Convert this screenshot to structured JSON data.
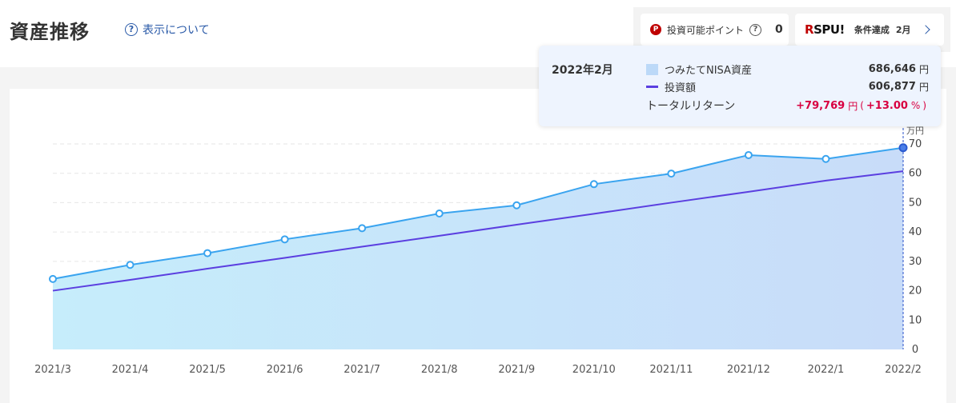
{
  "header": {
    "title": "資産推移",
    "help_label": "表示について",
    "points_label": "投資可能ポイント",
    "points_value": "0",
    "spu_logo_r": "R",
    "spu_logo_text": "SPU!",
    "spu_condition": "条件達成",
    "spu_month": "2月"
  },
  "tooltip": {
    "date": "2022年2月",
    "asset_label": "つみたてNISA資産",
    "asset_value": "686,646",
    "invest_label": "投資額",
    "invest_value": "606,877",
    "return_label": "トータルリターン",
    "return_value": "+79,769",
    "return_pct": "+13.00",
    "unit_yen": "円",
    "unit_pct": "%",
    "paren_open": "(",
    "paren_close": ")"
  },
  "colors": {
    "asset_line": "#3aa4ef",
    "asset_fill_left": "#c6edfb",
    "asset_fill_right": "#c8dcf9",
    "invest_line": "#5b3fe0",
    "grid": "#e6e6e6",
    "hover_line": "#2850c8"
  },
  "chart_data": {
    "type": "area",
    "categories": [
      "2021/3",
      "2021/4",
      "2021/5",
      "2021/6",
      "2021/7",
      "2021/8",
      "2021/9",
      "2021/10",
      "2021/11",
      "2021/12",
      "2022/1",
      "2022/2"
    ],
    "series": [
      {
        "name": "つみたてNISA資産",
        "type": "area",
        "values": [
          24.0,
          28.8,
          32.8,
          37.5,
          41.3,
          46.3,
          49.1,
          56.3,
          59.9,
          66.2,
          64.9,
          68.7
        ]
      },
      {
        "name": "投資額",
        "type": "line",
        "values": [
          20.0,
          23.7,
          27.5,
          31.2,
          35.0,
          38.7,
          42.5,
          46.2,
          50.0,
          53.7,
          57.5,
          60.7
        ]
      }
    ],
    "yunit": "万円",
    "ylim": [
      0,
      70
    ],
    "yticks": [
      0,
      10,
      20,
      30,
      40,
      50,
      60,
      70
    ],
    "grid": true,
    "highlight_index": 11
  }
}
